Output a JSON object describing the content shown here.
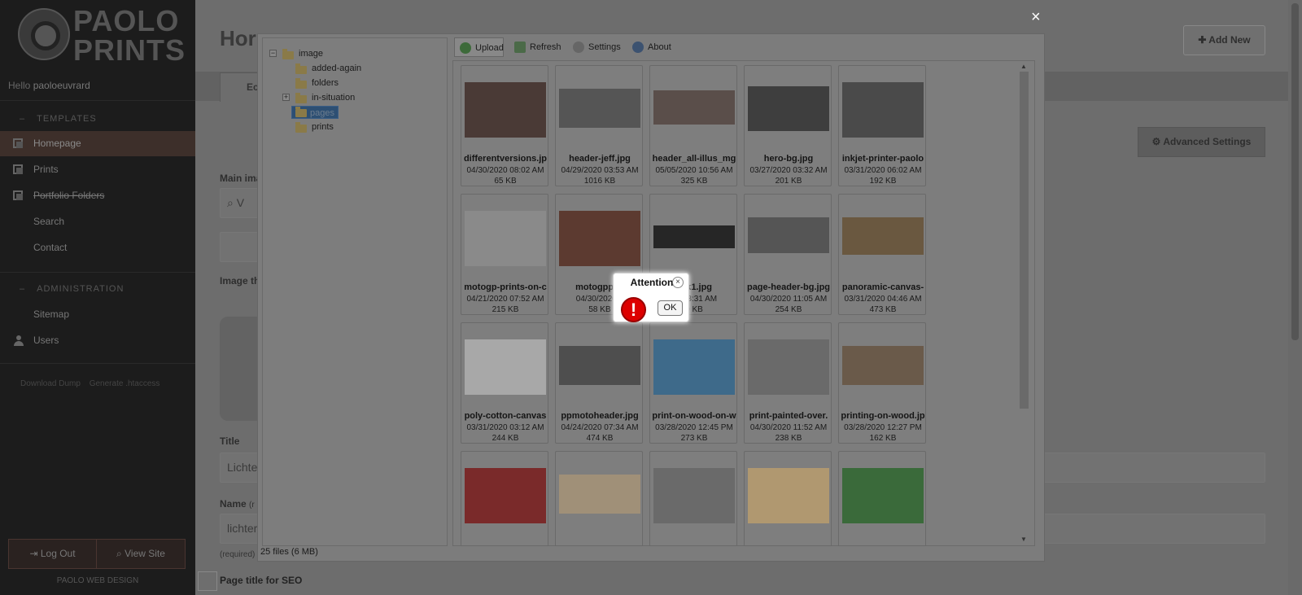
{
  "sidebar": {
    "logo_text": "PAOLO PRINTS",
    "hello": "Hello",
    "username": "paoloeuvrard",
    "templates_header": "TEMPLATES",
    "templates": [
      "Homepage",
      "Prints",
      "Portfolio Folders",
      "Search",
      "Contact"
    ],
    "admin_header": "ADMINISTRATION",
    "admin": [
      "Sitemap",
      "Users"
    ],
    "tools": [
      "Download Dump",
      "Generate .htaccess"
    ],
    "logout": "Log Out",
    "viewsite": "View Site",
    "footer": "PAOLO WEB DESIGN"
  },
  "main": {
    "title": "Hor",
    "add_new": "Add New",
    "tab_edit": "Ec",
    "advanced_settings": "Advanced Settings",
    "main_image_label": "Main ima",
    "search_placeholder": "V",
    "image_thumb_label": "Image th",
    "title_label": "Title",
    "title_value": "Lichte",
    "name_label": "Name",
    "name_hint": "(r",
    "name_value": "lichter",
    "required": "(required)",
    "seo_label": "Page title for SEO"
  },
  "dialog": {
    "close": "×",
    "toolbar": {
      "upload": "Upload",
      "refresh": "Refresh",
      "settings": "Settings",
      "about": "About"
    },
    "tree": {
      "root": "image",
      "children": [
        "added-again",
        "folders",
        "in-situation",
        "pages",
        "prints"
      ],
      "selected": "pages"
    },
    "files": [
      {
        "name": "differentversions.jp",
        "date": "04/30/2020 08:02 AM",
        "size": "65 KB"
      },
      {
        "name": "header-jeff.jpg",
        "date": "04/29/2020 03:53 AM",
        "size": "1016 KB"
      },
      {
        "name": "header_all-illus_mg",
        "date": "05/05/2020 10:56 AM",
        "size": "325 KB"
      },
      {
        "name": "hero-bg.jpg",
        "date": "03/27/2020 03:32 AM",
        "size": "201 KB"
      },
      {
        "name": "inkjet-printer-paolo",
        "date": "03/31/2020 06:02 AM",
        "size": "192 KB"
      },
      {
        "name": "motogp-prints-on-c",
        "date": "04/21/2020 07:52 AM",
        "size": "215 KB"
      },
      {
        "name": "motogppilo",
        "date": "04/30/2020 0",
        "size": "58 KB"
      },
      {
        "name": "ack1.jpg",
        "date": "20 03:31 AM",
        "size": "0 KB"
      },
      {
        "name": "page-header-bg.jpg",
        "date": "04/30/2020 11:05 AM",
        "size": "254 KB"
      },
      {
        "name": "panoramic-canvas-",
        "date": "03/31/2020 04:46 AM",
        "size": "473 KB"
      },
      {
        "name": "poly-cotton-canvas",
        "date": "03/31/2020 03:12 AM",
        "size": "244 KB"
      },
      {
        "name": "ppmotoheader.jpg",
        "date": "04/24/2020 07:34 AM",
        "size": "474 KB"
      },
      {
        "name": "print-on-wood-on-w",
        "date": "03/28/2020 12:45 PM",
        "size": "273 KB"
      },
      {
        "name": "print-painted-over.",
        "date": "04/30/2020 11:52 AM",
        "size": "238 KB"
      },
      {
        "name": "printing-on-wood.jp",
        "date": "03/28/2020 12:27 PM",
        "size": "162 KB"
      },
      {
        "name": "",
        "date": "",
        "size": ""
      },
      {
        "name": "",
        "date": "",
        "size": ""
      },
      {
        "name": "",
        "date": "",
        "size": ""
      },
      {
        "name": "",
        "date": "",
        "size": ""
      },
      {
        "name": "",
        "date": "",
        "size": ""
      }
    ],
    "status": "25 files (6 MB)"
  },
  "alert": {
    "title": "Attention",
    "icon": "!",
    "ok": "OK"
  },
  "thumb_colors": [
    "#4a3a36",
    "#555",
    "#5a4e4a",
    "#3e3e3e",
    "#4a4a4a",
    "#8a8a8a",
    "#5c3a30",
    "#262626",
    "#555",
    "#6a5840",
    "#a8a8a8",
    "#4e4e4e",
    "#3e6a8a",
    "#6a6a6a",
    "#6a5a4a",
    "#7a2a2a",
    "#a09078",
    "#6a6a6a",
    "#b09870",
    "#3a6a3a"
  ]
}
